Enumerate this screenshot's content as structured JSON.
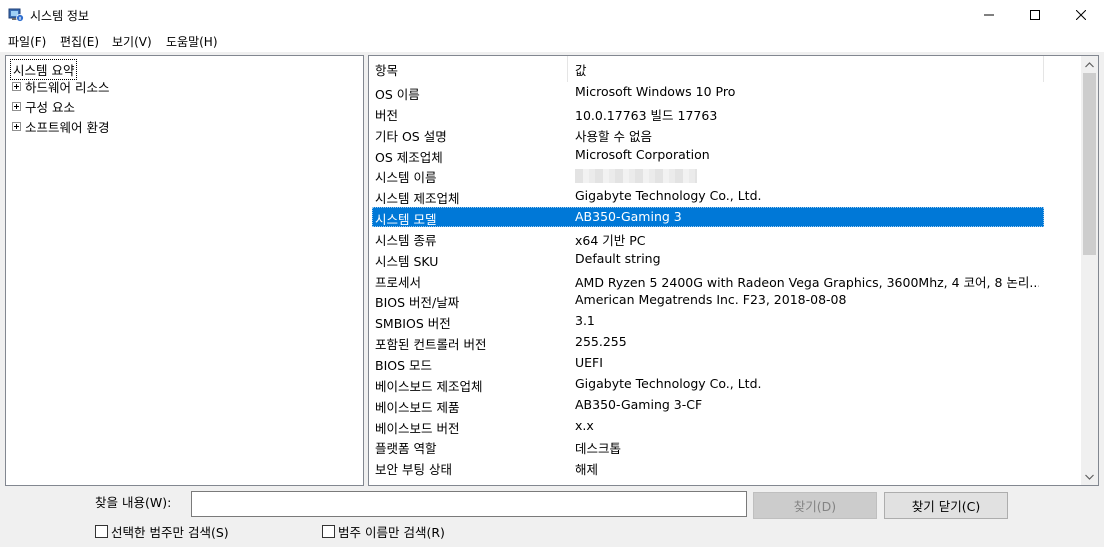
{
  "window": {
    "title": "시스템 정보"
  },
  "menu": [
    "파일(F)",
    "편집(E)",
    "보기(V)",
    "도움말(H)"
  ],
  "tree": {
    "root": "시스템 요약",
    "children": [
      "하드웨어 리소스",
      "구성 요소",
      "소프트웨어 환경"
    ]
  },
  "list": {
    "headers": {
      "item": "항목",
      "value": "값"
    },
    "rows": [
      {
        "item": "OS 이름",
        "value": "Microsoft Windows 10 Pro"
      },
      {
        "item": "버전",
        "value": "10.0.17763 빌드 17763"
      },
      {
        "item": "기타 OS 설명",
        "value": "사용할 수 없음"
      },
      {
        "item": "OS 제조업체",
        "value": "Microsoft Corporation"
      },
      {
        "item": "시스템 이름",
        "value": ""
      },
      {
        "item": "시스템 제조업체",
        "value": "Gigabyte Technology Co., Ltd."
      },
      {
        "item": "시스템 모델",
        "value": "AB350-Gaming 3"
      },
      {
        "item": "시스템 종류",
        "value": "x64 기반 PC"
      },
      {
        "item": "시스템 SKU",
        "value": "Default string"
      },
      {
        "item": "프로세서",
        "value": "AMD Ryzen 5 2400G with Radeon Vega Graphics, 3600Mhz, 4 코어, 8 논리..."
      },
      {
        "item": "BIOS 버전/날짜",
        "value": "American Megatrends Inc. F23, 2018-08-08"
      },
      {
        "item": "SMBIOS 버전",
        "value": "3.1"
      },
      {
        "item": "포함된 컨트롤러 버전",
        "value": "255.255"
      },
      {
        "item": "BIOS 모드",
        "value": "UEFI"
      },
      {
        "item": "베이스보드 제조업체",
        "value": "Gigabyte Technology Co., Ltd."
      },
      {
        "item": "베이스보드 제품",
        "value": "AB350-Gaming 3-CF"
      },
      {
        "item": "베이스보드 버전",
        "value": "x.x"
      },
      {
        "item": "플랫폼 역할",
        "value": "데스크톱"
      },
      {
        "item": "보안 부팅 상태",
        "value": "해제"
      }
    ]
  },
  "find": {
    "label": "찾을 내용(W):",
    "input_value": "",
    "find_button": "찾기(D)",
    "close_find_button": "찾기 닫기(C)",
    "checkbox_selected_category": "선택한 범주만 검색(S)",
    "checkbox_category_names": "범주 이름만 검색(R)"
  },
  "colors": {
    "selection": "#0078d7",
    "window_bg": "#f0f0f0"
  }
}
